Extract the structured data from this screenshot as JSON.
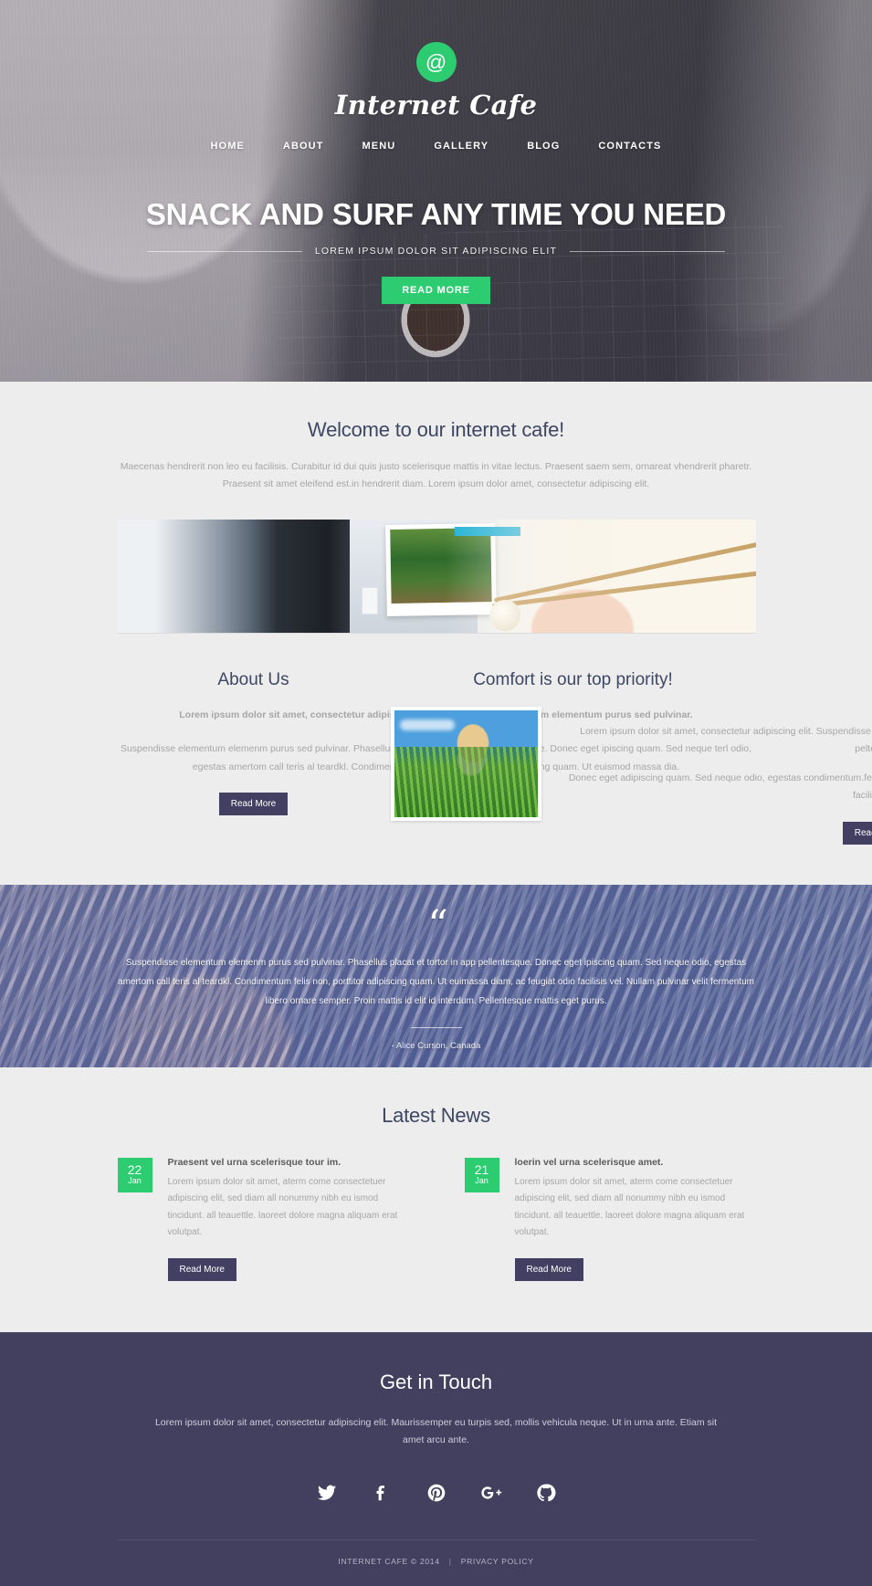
{
  "colors": {
    "accent_green": "#2ecc71",
    "dark_purple": "#433f5f",
    "heading_navy": "#3e4763",
    "body_bg": "#ededed"
  },
  "hero": {
    "logo_icon": "at-sign-icon",
    "logo_glyph": "@",
    "brand": "Internet Cafe",
    "nav": [
      {
        "label": "HOME"
      },
      {
        "label": "ABOUT"
      },
      {
        "label": "MENU"
      },
      {
        "label": "GALLERY"
      },
      {
        "label": "BLOG"
      },
      {
        "label": "CONTACTS"
      }
    ],
    "title": "SNACK AND SURF ANY TIME YOU NEED",
    "subtitle": "LOREM IPSUM DOLOR SIT ADIPISCING ELIT",
    "cta": "READ MORE"
  },
  "welcome": {
    "title": "Welcome to our internet cafe!",
    "paragraph": "Maecenas hendrerit non leo eu facilisis. Curabitur id dui quis justo scelerisque mattis in vitae lectus. Praesent saem sem, ornareat vhendrerit pharetr. Praesent sit amet eleifend est.in hendrerit diam. Lorem ipsum dolor  amet, consectetur adipiscing elit."
  },
  "about": {
    "title": "About Us",
    "lead": "Lorem ipsum dolor sit amet, consectetur adipiscing elit. Suspendisse elementum elementum purus sed pulvinar.",
    "body": "Suspendisse elementum elemenm purus sed pulvinar. Phasellus placat et tortor in app pellentesque. Donec eget ipiscing quam. Sed neque terl odio, egestas amertom call  teris al teardkl. Condimentum felis non, alle porttitor adipiscing quam. Ut euismod massa dia.",
    "cta": "Read More"
  },
  "comfort": {
    "title": "Comfort is our top priority!",
    "image_alt": "woman-in-field-photo",
    "body1": "Lorem ipsum dolor sit amet, consectetur adipiscing elit. Suspendisse elementum elementum purus sed pulnar. Phasellus placerat et tortor in peltesque.",
    "body2": "Donec eget adipiscing quam. Sed neque odio, egestas condimentum.felis non, porttitor adipiscing quam. Ut euismod massa diam, ac feugiat odio facilisis vel.",
    "cta": "Read More"
  },
  "testimonial": {
    "quote_icon": "quotation-mark-icon",
    "text": "Suspendisse elementum elemenm purus sed pulvinar. Phasellus placat et tortor in app pellentesque. Donec eget ipiscing quam. Sed neque odio, egestas amertom call  teris al teardkl. Condimentum felis non, porttitor adipiscing quam. Ut euimassa diam, ac feugiat odio facilisis vel. Nullam pulvinar velit fermentum libero ornare semper. Proin mattis id elit id interdum. Pellentesque mattis eget purus.",
    "author": "- Alice Curson, Canada"
  },
  "news": {
    "title": "Latest News",
    "items": [
      {
        "day": "22",
        "month": "Jan",
        "title": "Praesent vel urna scelerisque tour im.",
        "text": "Lorem ipsum dolor sit amet, aterm come consectetuer adipiscing elit, sed diam all nonummy nibh eu ismod  tincidunt. all teauettle. laoreet dolore magna aliquam erat volutpat.",
        "cta": "Read More"
      },
      {
        "day": "21",
        "month": "Jan",
        "title": "loerin  vel urna scelerisque amet.",
        "text": "Lorem ipsum dolor sit amet, aterm come consectetuer adipiscing elit, sed diam all nonummy nibh eu ismod  tincidunt. all teauettle. laoreet dolore magna aliquam erat volutpat.",
        "cta": "Read More"
      }
    ]
  },
  "footer": {
    "title": "Get in Touch",
    "text": "Lorem ipsum dolor sit amet, consectetur adipiscing elit. Maurissemper eu turpis sed, mollis vehicula neque. Ut in urna ante. Etiam sit amet arcu ante.",
    "socials": [
      {
        "name": "twitter-icon",
        "label": "Twitter"
      },
      {
        "name": "facebook-icon",
        "label": "Facebook"
      },
      {
        "name": "pinterest-icon",
        "label": "Pinterest"
      },
      {
        "name": "google-plus-icon",
        "label": "Google Plus"
      },
      {
        "name": "github-icon",
        "label": "GitHub"
      }
    ],
    "copyright": "INTERNET CAFE © 2014",
    "separator": "|",
    "privacy": "PRIVACY POLICY"
  }
}
